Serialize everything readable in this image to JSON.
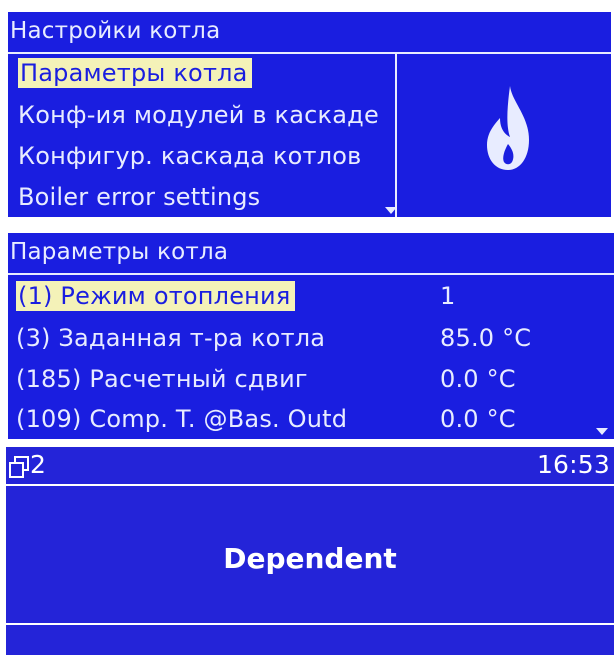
{
  "panel1": {
    "title": "Настройки котла",
    "items": [
      "Параметры котла",
      "Конф-ия модулей в каскаде",
      "Конфигур. каскада котлов",
      "Boiler error settings"
    ],
    "selected_index": 0,
    "icon": "flame-icon"
  },
  "panel2": {
    "title": "Параметры котла",
    "rows": [
      {
        "label": "(1) Режим отопления",
        "value": "1"
      },
      {
        "label": "(3) Заданная т-ра котла",
        "value": "85.0 °C"
      },
      {
        "label": "(185) Расчетный сдвиг",
        "value": "0.0 °C"
      },
      {
        "label": "(109) Comp. T. @Bas. Outd",
        "value": "0.0 °C"
      }
    ],
    "selected_index": 0
  },
  "panel3": {
    "module_number": "2",
    "module_icon": "module-icon",
    "time": "16:53",
    "status": "Dependent"
  },
  "colors": {
    "screen_bg": "#1a1ee0",
    "text": "#e8ecff",
    "highlight_bg": "#f4f2b8"
  }
}
